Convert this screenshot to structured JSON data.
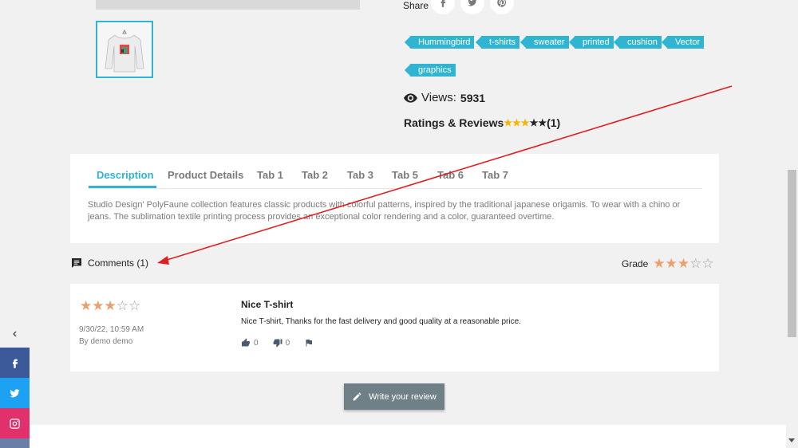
{
  "share": {
    "label": "Share"
  },
  "tags": [
    "Hummingbird",
    "t-shirts",
    "sweater",
    "printed",
    "cushion",
    "Vector",
    "graphics"
  ],
  "views": {
    "label": "Views:",
    "count": "5931"
  },
  "ratings": {
    "label": "Ratings & Reviews",
    "count": "(1)",
    "stars": 3,
    "max": 5
  },
  "tabs": [
    "Description",
    "Product Details",
    "Tab 1",
    "Tab 2",
    "Tab 3",
    "Tab 5",
    "Tab 6",
    "Tab 7"
  ],
  "active_tab": "Description",
  "description": "Studio Design' PolyFaune collection features classic products with colorful patterns, inspired by the traditional japanese origamis. To wear with a chino or jeans. The sublimation textile printing process provides an exceptional color rendering and a color, guaranteed overtime.",
  "comments": {
    "label": "Comments (1)",
    "grade_label": "Grade",
    "grade": 3,
    "grade_max": 5
  },
  "review": {
    "rating": 3,
    "date": "9/30/22, 10:59 AM",
    "author": "By demo demo",
    "title": "Nice T-shirt",
    "text": "Nice T-shirt, Thanks for the fast delivery and good quality at a reasonable price.",
    "useful_count": "0",
    "not_useful_count": "0"
  },
  "write_review": {
    "label": "Write your review"
  },
  "social_toggle": "‹",
  "social": [
    "facebook",
    "twitter",
    "instagram"
  ],
  "colors": {
    "accent": "#2fb5d2",
    "star_orange": "#e8a06c",
    "star_yellow": "#f4b400",
    "annotation": "#e02020",
    "facebook": "#3b5998",
    "twitter": "#1da1f2",
    "instagram": "#e1306c"
  }
}
